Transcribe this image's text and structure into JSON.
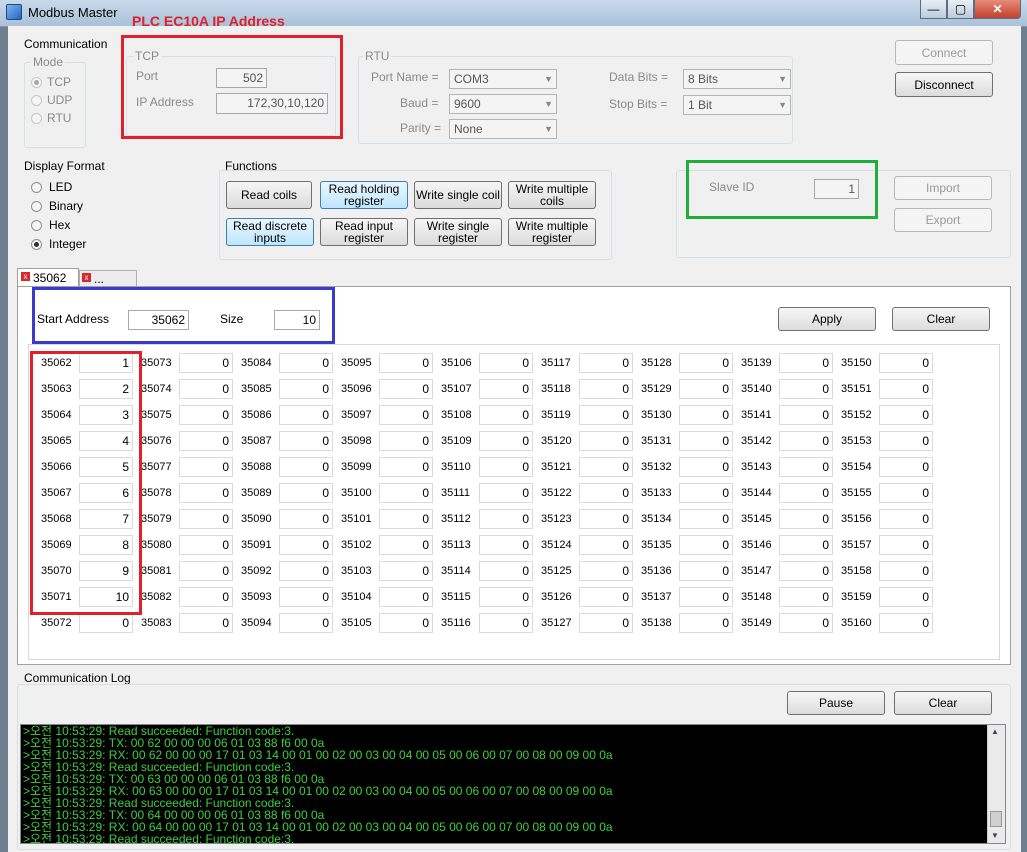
{
  "window": {
    "title": "Modbus Master",
    "min_glyph": "—",
    "max_glyph": "▢",
    "close_glyph": "✕"
  },
  "annotation": {
    "plc_label": "PLC EC10A IP Address",
    "colors": {
      "red": "#e0202a",
      "green": "#1fae3a",
      "blue": "#3a3ad0"
    }
  },
  "communication": {
    "title": "Communication",
    "mode": {
      "title": "Mode",
      "options": [
        "TCP",
        "UDP",
        "RTU"
      ],
      "selected": "TCP"
    },
    "tcp": {
      "title": "TCP",
      "port_label": "Port",
      "port_value": "502",
      "ip_label": "IP Address",
      "ip_value": "172,30,10,120"
    },
    "rtu": {
      "title": "RTU",
      "port_name_label": "Port Name =",
      "port_name_value": "COM3",
      "baud_label": "Baud =",
      "baud_value": "9600",
      "parity_label": "Parity =",
      "parity_value": "None",
      "data_bits_label": "Data Bits =",
      "data_bits_value": "8 Bits",
      "stop_bits_label": "Stop Bits =",
      "stop_bits_value": "1 Bit"
    },
    "connect_label": "Connect",
    "disconnect_label": "Disconnect"
  },
  "display_format": {
    "title": "Display Format",
    "options": [
      "LED",
      "Binary",
      "Hex",
      "Integer"
    ],
    "selected": "Integer"
  },
  "functions": {
    "title": "Functions",
    "row1": [
      "Read coils",
      "Read holding register",
      "Write single coil",
      "Write multiple coils"
    ],
    "row2": [
      "Read discrete inputs",
      "Read input register",
      "Write single register",
      "Write multiple register"
    ]
  },
  "slave": {
    "label": "Slave ID",
    "value": "1",
    "import_label": "Import",
    "export_label": "Export"
  },
  "tabs": [
    {
      "label": "35062"
    },
    {
      "label": "..."
    }
  ],
  "range": {
    "start_label": "Start Address",
    "start_value": "35062",
    "size_label": "Size",
    "size_value": "10",
    "apply_label": "Apply",
    "clear_label": "Clear"
  },
  "registers": {
    "columns": [
      {
        "addresses": [
          "35062",
          "35063",
          "35064",
          "35065",
          "35066",
          "35067",
          "35068",
          "35069",
          "35070",
          "35071",
          "35072"
        ],
        "values": [
          "1",
          "2",
          "3",
          "4",
          "5",
          "6",
          "7",
          "8",
          "9",
          "10",
          "0"
        ]
      },
      {
        "addresses": [
          "35073",
          "35074",
          "35075",
          "35076",
          "35077",
          "35078",
          "35079",
          "35080",
          "35081",
          "35082",
          "35083"
        ],
        "values": [
          "0",
          "0",
          "0",
          "0",
          "0",
          "0",
          "0",
          "0",
          "0",
          "0",
          "0"
        ]
      },
      {
        "addresses": [
          "35084",
          "35085",
          "35086",
          "35087",
          "35088",
          "35089",
          "35090",
          "35091",
          "35092",
          "35093",
          "35094"
        ],
        "values": [
          "0",
          "0",
          "0",
          "0",
          "0",
          "0",
          "0",
          "0",
          "0",
          "0",
          "0"
        ]
      },
      {
        "addresses": [
          "35095",
          "35096",
          "35097",
          "35098",
          "35099",
          "35100",
          "35101",
          "35102",
          "35103",
          "35104",
          "35105"
        ],
        "values": [
          "0",
          "0",
          "0",
          "0",
          "0",
          "0",
          "0",
          "0",
          "0",
          "0",
          "0"
        ]
      },
      {
        "addresses": [
          "35106",
          "35107",
          "35108",
          "35109",
          "35110",
          "35111",
          "35112",
          "35113",
          "35114",
          "35115",
          "35116"
        ],
        "values": [
          "0",
          "0",
          "0",
          "0",
          "0",
          "0",
          "0",
          "0",
          "0",
          "0",
          "0"
        ]
      },
      {
        "addresses": [
          "35117",
          "35118",
          "35119",
          "35120",
          "35121",
          "35122",
          "35123",
          "35124",
          "35125",
          "35126",
          "35127"
        ],
        "values": [
          "0",
          "0",
          "0",
          "0",
          "0",
          "0",
          "0",
          "0",
          "0",
          "0",
          "0"
        ]
      },
      {
        "addresses": [
          "35128",
          "35129",
          "35130",
          "35131",
          "35132",
          "35133",
          "35134",
          "35135",
          "35136",
          "35137",
          "35138"
        ],
        "values": [
          "0",
          "0",
          "0",
          "0",
          "0",
          "0",
          "0",
          "0",
          "0",
          "0",
          "0"
        ]
      },
      {
        "addresses": [
          "35139",
          "35140",
          "35141",
          "35142",
          "35143",
          "35144",
          "35145",
          "35146",
          "35147",
          "35148",
          "35149"
        ],
        "values": [
          "0",
          "0",
          "0",
          "0",
          "0",
          "0",
          "0",
          "0",
          "0",
          "0",
          "0"
        ]
      },
      {
        "addresses": [
          "35150",
          "35151",
          "35152",
          "35153",
          "35154",
          "35155",
          "35156",
          "35157",
          "35158",
          "35159",
          "35160"
        ],
        "values": [
          "0",
          "0",
          "0",
          "0",
          "0",
          "0",
          "0",
          "0",
          "0",
          "0",
          "0"
        ]
      }
    ]
  },
  "log": {
    "title": "Communication Log",
    "pause_label": "Pause",
    "clear_label": "Clear",
    "lines": [
      ">오전 10:53:29: Read succeeded: Function code:3.",
      ">오전 10:53:29: TX: 00 62 00 00 00 06 01 03 88 f6 00 0a",
      ">오전 10:53:29: RX: 00 62 00 00 00 17 01 03 14 00 01 00 02 00 03 00 04 00 05 00 06 00 07 00 08 00 09 00 0a",
      ">오전 10:53:29: Read succeeded: Function code:3.",
      ">오전 10:53:29: TX: 00 63 00 00 00 06 01 03 88 f6 00 0a",
      ">오전 10:53:29: RX: 00 63 00 00 00 17 01 03 14 00 01 00 02 00 03 00 04 00 05 00 06 00 07 00 08 00 09 00 0a",
      ">오전 10:53:29: Read succeeded: Function code:3.",
      ">오전 10:53:29: TX: 00 64 00 00 00 06 01 03 88 f6 00 0a",
      ">오전 10:53:29: RX: 00 64 00 00 00 17 01 03 14 00 01 00 02 00 03 00 04 00 05 00 06 00 07 00 08 00 09 00 0a",
      ">오전 10:53:29: Read succeeded: Function code:3."
    ]
  }
}
